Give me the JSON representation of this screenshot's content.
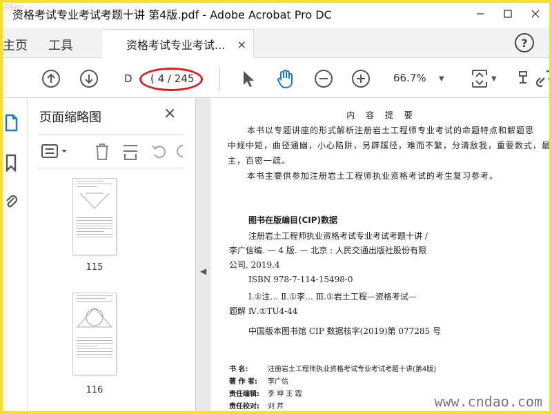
{
  "window": {
    "title": "资格考试专业考试考题十讲 第4版.pdf - Adobe Acrobat Pro DC",
    "watermark_corner": "资料Q"
  },
  "nav": {
    "home": "主页",
    "tools": "工具"
  },
  "doc_tab": {
    "label": "资格考试专业考试...",
    "close": "×"
  },
  "help_label": "?",
  "toolbar": {
    "page_field": "D",
    "page_count": "( 4 / 245",
    "zoom": "66.7%"
  },
  "thumbnail_panel": {
    "title": "页面缩略图",
    "close": "×",
    "pages": [
      {
        "number": "115"
      },
      {
        "number": "116"
      }
    ]
  },
  "document": {
    "heading": "内 容 提 要",
    "intro": [
      "本书以专题讲座的形式解析注册岩土工程师专业考试的命题特点和解题思",
      "中规中矩，曲径通幽，小心陷阱，另辟蹊径，难而不繁，分清敌我，重要数式，最大",
      "主，百密一疏。",
      "本书主要供参加注册岩土工程师执业资格考试的考生复习参考。"
    ],
    "cip_heading": "图书在版编目(CIP)数据",
    "cip_lines": [
      "注册岩土工程师执业资格考试专业考试考题十讲 /",
      "李广信编. — 4 版. — 北京 : 人民交通出版社股份有限",
      "公司, 2019.4",
      "ISBN  978-7-114-15498-0",
      "Ⅰ.①注…   Ⅱ.①李…   Ⅲ.①岩土工程—资格考试—",
      "题解   Ⅳ.①TU4-44",
      "中国版本图书馆 CIP 数据核字(2019)第 077285 号"
    ],
    "meta": [
      {
        "label": "书    名:",
        "value": "注册岩土工程师执业资格考试专业考试考题十讲(第4版)"
      },
      {
        "label": "著 作 者:",
        "value": "李广信"
      },
      {
        "label": "责任编辑:",
        "value": "李  坤  王  霞"
      },
      {
        "label": "责任校对:",
        "value": "刘  芹"
      }
    ],
    "watermark": "www.cndao.com"
  },
  "colors": {
    "accent": "#1473e6",
    "highlight_oval": "#d91f1f",
    "frame": "#f3e22a"
  }
}
